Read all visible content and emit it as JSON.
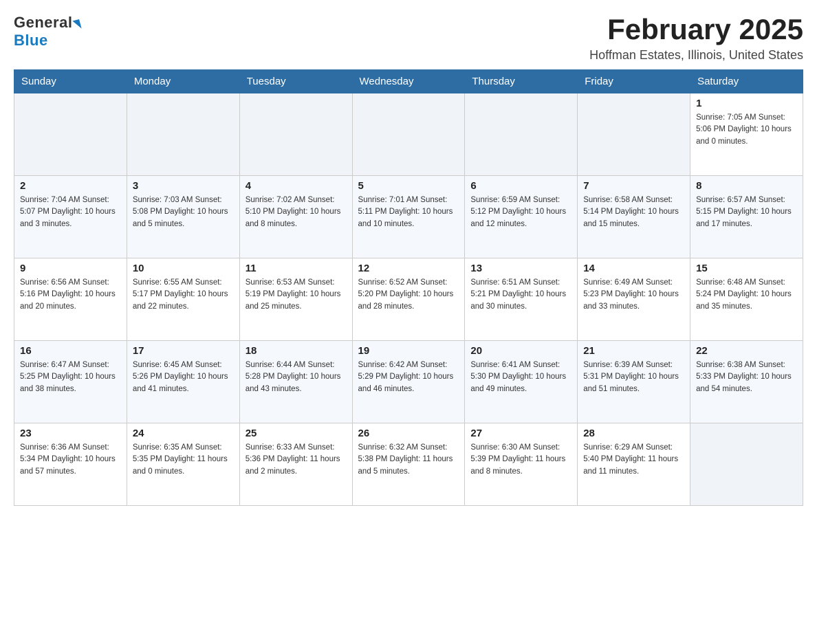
{
  "header": {
    "logo_general": "General",
    "logo_blue": "Blue",
    "title": "February 2025",
    "subtitle": "Hoffman Estates, Illinois, United States"
  },
  "weekdays": [
    "Sunday",
    "Monday",
    "Tuesday",
    "Wednesday",
    "Thursday",
    "Friday",
    "Saturday"
  ],
  "weeks": [
    [
      {
        "day": "",
        "info": ""
      },
      {
        "day": "",
        "info": ""
      },
      {
        "day": "",
        "info": ""
      },
      {
        "day": "",
        "info": ""
      },
      {
        "day": "",
        "info": ""
      },
      {
        "day": "",
        "info": ""
      },
      {
        "day": "1",
        "info": "Sunrise: 7:05 AM\nSunset: 5:06 PM\nDaylight: 10 hours and 0 minutes."
      }
    ],
    [
      {
        "day": "2",
        "info": "Sunrise: 7:04 AM\nSunset: 5:07 PM\nDaylight: 10 hours and 3 minutes."
      },
      {
        "day": "3",
        "info": "Sunrise: 7:03 AM\nSunset: 5:08 PM\nDaylight: 10 hours and 5 minutes."
      },
      {
        "day": "4",
        "info": "Sunrise: 7:02 AM\nSunset: 5:10 PM\nDaylight: 10 hours and 8 minutes."
      },
      {
        "day": "5",
        "info": "Sunrise: 7:01 AM\nSunset: 5:11 PM\nDaylight: 10 hours and 10 minutes."
      },
      {
        "day": "6",
        "info": "Sunrise: 6:59 AM\nSunset: 5:12 PM\nDaylight: 10 hours and 12 minutes."
      },
      {
        "day": "7",
        "info": "Sunrise: 6:58 AM\nSunset: 5:14 PM\nDaylight: 10 hours and 15 minutes."
      },
      {
        "day": "8",
        "info": "Sunrise: 6:57 AM\nSunset: 5:15 PM\nDaylight: 10 hours and 17 minutes."
      }
    ],
    [
      {
        "day": "9",
        "info": "Sunrise: 6:56 AM\nSunset: 5:16 PM\nDaylight: 10 hours and 20 minutes."
      },
      {
        "day": "10",
        "info": "Sunrise: 6:55 AM\nSunset: 5:17 PM\nDaylight: 10 hours and 22 minutes."
      },
      {
        "day": "11",
        "info": "Sunrise: 6:53 AM\nSunset: 5:19 PM\nDaylight: 10 hours and 25 minutes."
      },
      {
        "day": "12",
        "info": "Sunrise: 6:52 AM\nSunset: 5:20 PM\nDaylight: 10 hours and 28 minutes."
      },
      {
        "day": "13",
        "info": "Sunrise: 6:51 AM\nSunset: 5:21 PM\nDaylight: 10 hours and 30 minutes."
      },
      {
        "day": "14",
        "info": "Sunrise: 6:49 AM\nSunset: 5:23 PM\nDaylight: 10 hours and 33 minutes."
      },
      {
        "day": "15",
        "info": "Sunrise: 6:48 AM\nSunset: 5:24 PM\nDaylight: 10 hours and 35 minutes."
      }
    ],
    [
      {
        "day": "16",
        "info": "Sunrise: 6:47 AM\nSunset: 5:25 PM\nDaylight: 10 hours and 38 minutes."
      },
      {
        "day": "17",
        "info": "Sunrise: 6:45 AM\nSunset: 5:26 PM\nDaylight: 10 hours and 41 minutes."
      },
      {
        "day": "18",
        "info": "Sunrise: 6:44 AM\nSunset: 5:28 PM\nDaylight: 10 hours and 43 minutes."
      },
      {
        "day": "19",
        "info": "Sunrise: 6:42 AM\nSunset: 5:29 PM\nDaylight: 10 hours and 46 minutes."
      },
      {
        "day": "20",
        "info": "Sunrise: 6:41 AM\nSunset: 5:30 PM\nDaylight: 10 hours and 49 minutes."
      },
      {
        "day": "21",
        "info": "Sunrise: 6:39 AM\nSunset: 5:31 PM\nDaylight: 10 hours and 51 minutes."
      },
      {
        "day": "22",
        "info": "Sunrise: 6:38 AM\nSunset: 5:33 PM\nDaylight: 10 hours and 54 minutes."
      }
    ],
    [
      {
        "day": "23",
        "info": "Sunrise: 6:36 AM\nSunset: 5:34 PM\nDaylight: 10 hours and 57 minutes."
      },
      {
        "day": "24",
        "info": "Sunrise: 6:35 AM\nSunset: 5:35 PM\nDaylight: 11 hours and 0 minutes."
      },
      {
        "day": "25",
        "info": "Sunrise: 6:33 AM\nSunset: 5:36 PM\nDaylight: 11 hours and 2 minutes."
      },
      {
        "day": "26",
        "info": "Sunrise: 6:32 AM\nSunset: 5:38 PM\nDaylight: 11 hours and 5 minutes."
      },
      {
        "day": "27",
        "info": "Sunrise: 6:30 AM\nSunset: 5:39 PM\nDaylight: 11 hours and 8 minutes."
      },
      {
        "day": "28",
        "info": "Sunrise: 6:29 AM\nSunset: 5:40 PM\nDaylight: 11 hours and 11 minutes."
      },
      {
        "day": "",
        "info": ""
      }
    ]
  ]
}
